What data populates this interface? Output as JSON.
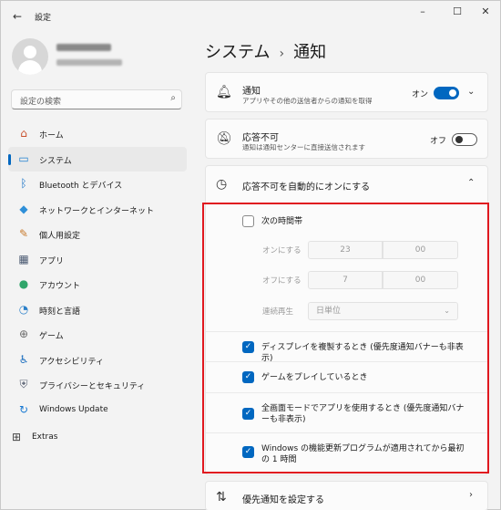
{
  "app": {
    "title": "設定",
    "back_icon": "back-arrow-icon"
  },
  "window_controls": {
    "minimize": "–",
    "maximize": "☐",
    "close": "✕"
  },
  "search": {
    "placeholder": "設定の検索"
  },
  "sidebar": {
    "items": [
      {
        "label": "ホーム",
        "icon": "home-icon",
        "glyph": "⌂",
        "color": "#c9512d",
        "active": false
      },
      {
        "label": "システム",
        "icon": "system-icon",
        "glyph": "▭",
        "color": "#1d7fd1",
        "active": true
      },
      {
        "label": "Bluetooth とデバイス",
        "icon": "bluetooth-icon",
        "glyph": "ᛒ",
        "color": "#1a73c6",
        "active": false
      },
      {
        "label": "ネットワークとインターネット",
        "icon": "network-icon",
        "glyph": "◆",
        "color": "#2e8fd8",
        "active": false
      },
      {
        "label": "個人用設定",
        "icon": "brush-icon",
        "glyph": "✎",
        "color": "#c77a2c",
        "active": false
      },
      {
        "label": "アプリ",
        "icon": "apps-icon",
        "glyph": "▦",
        "color": "#4b5a72",
        "active": false
      },
      {
        "label": "アカウント",
        "icon": "account-icon",
        "glyph": "●",
        "color": "#2fa56a",
        "active": false
      },
      {
        "label": "時刻と言語",
        "icon": "time-language-icon",
        "glyph": "◔",
        "color": "#2b80c9",
        "active": false
      },
      {
        "label": "ゲーム",
        "icon": "gaming-icon",
        "glyph": "⊕",
        "color": "#6a6a6a",
        "active": false
      },
      {
        "label": "アクセシビリティ",
        "icon": "accessibility-icon",
        "glyph": "♿",
        "color": "#1d6fbf",
        "active": false
      },
      {
        "label": "プライバシーとセキュリティ",
        "icon": "shield-icon",
        "glyph": "⛨",
        "color": "#5c6475",
        "active": false
      },
      {
        "label": "Windows Update",
        "icon": "windows-update-icon",
        "glyph": "↻",
        "color": "#1778d2",
        "active": false
      }
    ],
    "extras": {
      "label": "Extras",
      "icon": "extras-icon",
      "glyph": "⊞"
    }
  },
  "page": {
    "breadcrumb_parent": "システム",
    "separator": "›",
    "title": "通知"
  },
  "notifications": {
    "title": "通知",
    "subtitle": "アプリやその他の送信者からの通知を取得",
    "toggle_label": "オン",
    "state": "on"
  },
  "dnd": {
    "title": "応答不可",
    "subtitle": "通知は通知センターに直接送信されます",
    "toggle_label": "オフ",
    "state": "off"
  },
  "auto_dnd": {
    "title": "応答不可を自動的にオンにする",
    "schedule": {
      "label": "次の時間帯",
      "checked": false,
      "on_label": "オンにする",
      "on_hour": "23",
      "on_minute": "00",
      "off_label": "オフにする",
      "off_hour": "7",
      "off_minute": "00",
      "repeat_label": "連続再生",
      "repeat_value": "日単位"
    },
    "options": [
      {
        "label": "ディスプレイを複製するとき (優先度通知バナーも非表示)",
        "checked": true
      },
      {
        "label": "ゲームをプレイしているとき",
        "checked": true
      },
      {
        "label": "全画面モードでアプリを使用するとき (優先度通知バナーも非表示)",
        "checked": true
      },
      {
        "label": "Windows の機能更新プログラムが適用されてから最初の 1 時間",
        "checked": true
      }
    ]
  },
  "priority": {
    "title": "優先通知を設定する"
  },
  "colors": {
    "accent": "#0067c0",
    "highlight": "#e0181f"
  }
}
